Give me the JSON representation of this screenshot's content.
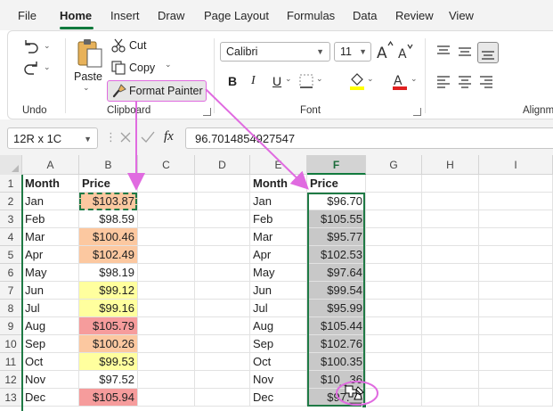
{
  "menu": {
    "tabs": [
      "File",
      "Home",
      "Insert",
      "Draw",
      "Page Layout",
      "Formulas",
      "Data",
      "Review",
      "View"
    ],
    "active_tab": "Home"
  },
  "ribbon": {
    "undo_group": {
      "label": "Undo"
    },
    "clipboard": {
      "paste_label": "Paste",
      "cut_label": "Cut",
      "copy_label": "Copy",
      "format_painter_label": "Format Painter",
      "group_label": "Clipboard"
    },
    "font": {
      "font_name": "Calibri",
      "font_size": "11",
      "bold_label": "B",
      "italic_label": "I",
      "underline_label": "U",
      "group_label": "Font",
      "fill_color": "#ffff00",
      "font_color": "#e02020"
    },
    "alignment": {
      "group_label": "Alignm"
    }
  },
  "formula_bar": {
    "name_box": "12R x 1C",
    "fx_label": "fx",
    "formula": "96.7014854927547"
  },
  "grid": {
    "columns": [
      "A",
      "B",
      "C",
      "D",
      "E",
      "F",
      "G",
      "H",
      "I"
    ],
    "selected_column": "F",
    "rows": [
      "1",
      "2",
      "3",
      "4",
      "5",
      "6",
      "7",
      "8",
      "9",
      "10",
      "11",
      "12",
      "13"
    ],
    "left_table": {
      "headers": [
        "Month",
        "Price"
      ],
      "months": [
        "Jan",
        "Feb",
        "Mar",
        "Apr",
        "May",
        "Jun",
        "Jul",
        "Aug",
        "Sep",
        "Oct",
        "Nov",
        "Dec"
      ],
      "prices": [
        "$103.87",
        "$98.59",
        "$100.46",
        "$102.49",
        "$98.19",
        "$99.12",
        "$99.16",
        "$105.79",
        "$100.26",
        "$99.53",
        "$97.52",
        "$105.94"
      ],
      "fills": [
        "orange",
        "none",
        "orange",
        "orange",
        "none",
        "yellow",
        "yellow",
        "red",
        "orange",
        "yellow",
        "none",
        "red"
      ]
    },
    "right_table": {
      "headers": [
        "Month",
        "Price"
      ],
      "months": [
        "Jan",
        "Feb",
        "Mar",
        "Apr",
        "May",
        "Jun",
        "Jul",
        "Aug",
        "Sep",
        "Oct",
        "Nov",
        "Dec"
      ],
      "prices": [
        "$96.70",
        "$105.55",
        "$95.77",
        "$102.53",
        "$97.64",
        "$99.54",
        "$95.99",
        "$105.44",
        "$102.76",
        "$100.35",
        "$10_.36",
        "$97.__"
      ],
      "fills": [
        "none",
        "gray",
        "gray",
        "gray",
        "gray",
        "gray",
        "gray",
        "gray",
        "gray",
        "gray",
        "gray",
        "gray"
      ]
    }
  },
  "colors": {
    "accent_green": "#117a3d",
    "annotation_magenta": "#e06be0",
    "fill_orange": "#fcc8a0",
    "fill_yellow": "#ffff9e",
    "fill_red": "#f69c9c",
    "fill_gray": "#c8c8c8"
  },
  "icons": [
    "undo-icon",
    "redo-icon",
    "paste-icon",
    "cut-icon",
    "copy-icon",
    "format-painter-icon",
    "fill-color-icon",
    "font-color-icon",
    "increase-font-icon",
    "decrease-font-icon",
    "borders-icon",
    "align-top-icon",
    "align-middle-icon",
    "align-bottom-icon",
    "cancel-icon",
    "enter-icon",
    "paintbrush-cursor-icon"
  ]
}
